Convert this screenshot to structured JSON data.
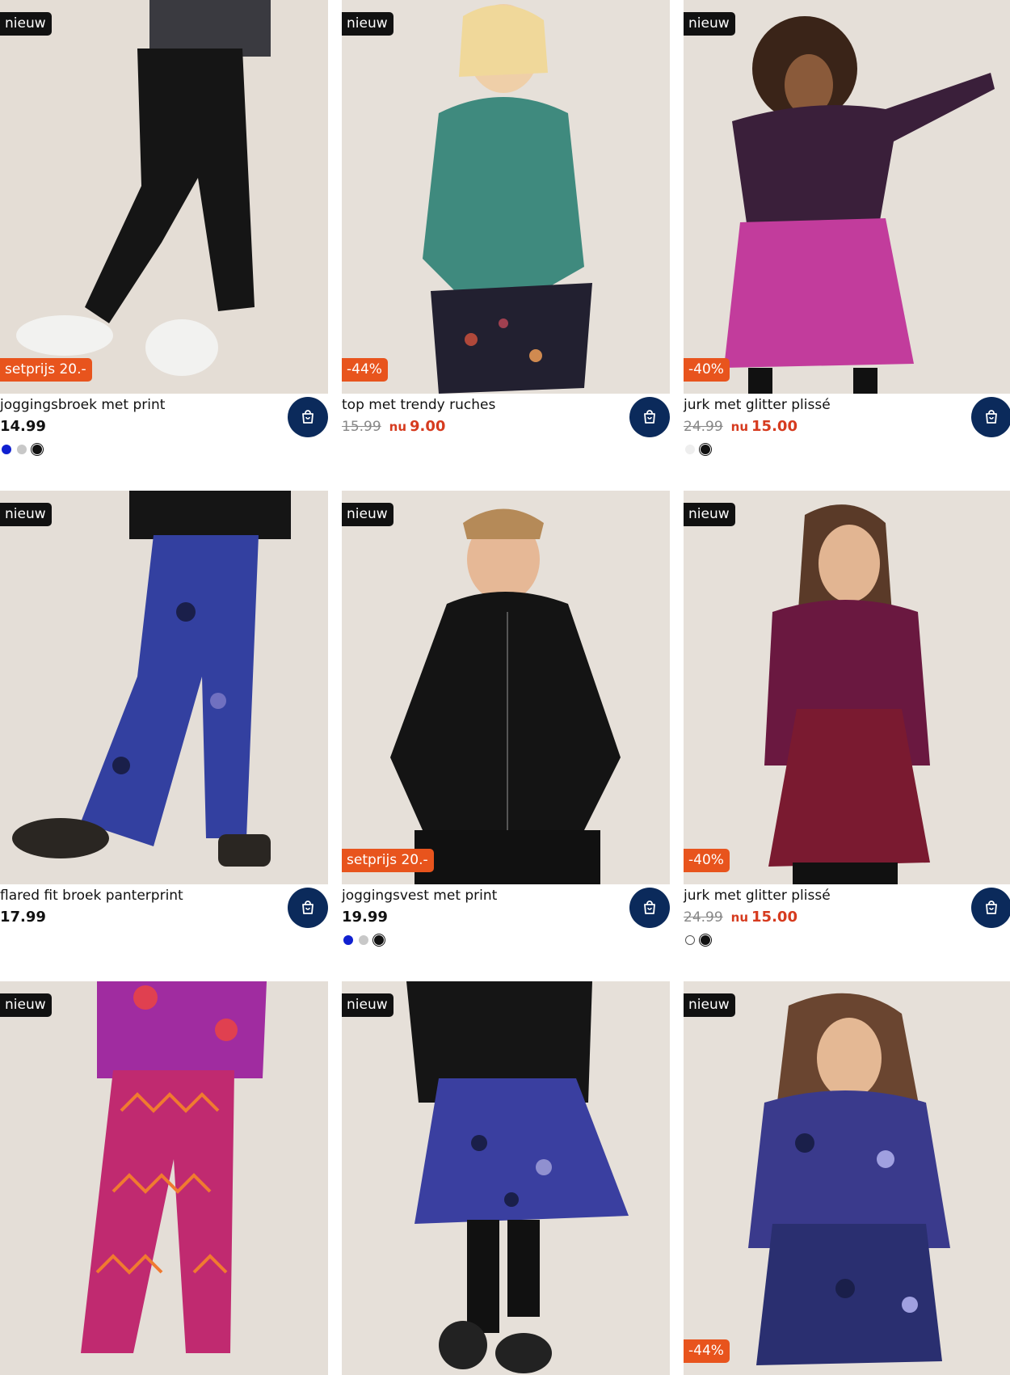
{
  "products": [
    {
      "name": "joggingsbroek met print",
      "badge_top": "nieuw",
      "badge_bottom": "setprijs 20.-",
      "price": "14.99",
      "old_price": "",
      "now_label": "",
      "new_price": "",
      "swatches": [
        "#1020d0",
        "#c8c8c8",
        "#111111"
      ]
    },
    {
      "name": "top met trendy ruches",
      "badge_top": "nieuw",
      "badge_bottom": "-44%",
      "price": "",
      "old_price": "15.99",
      "now_label": "nu",
      "new_price": "9.00",
      "swatches": []
    },
    {
      "name": "jurk met glitter plissé",
      "badge_top": "nieuw",
      "badge_bottom": "-40%",
      "price": "",
      "old_price": "24.99",
      "now_label": "nu",
      "new_price": "15.00",
      "swatches": [
        "#eeeeee",
        "#111111"
      ]
    },
    {
      "name": "flared fit broek panterprint",
      "badge_top": "nieuw",
      "badge_bottom": "",
      "price": "17.99",
      "old_price": "",
      "now_label": "",
      "new_price": "",
      "swatches": []
    },
    {
      "name": "joggingsvest met print",
      "badge_top": "nieuw",
      "badge_bottom": "setprijs 20.-",
      "price": "19.99",
      "old_price": "",
      "now_label": "",
      "new_price": "",
      "swatches": [
        "#1020d0",
        "#c8c8c8",
        "#111111"
      ]
    },
    {
      "name": "jurk met glitter plissé",
      "badge_top": "nieuw",
      "badge_bottom": "-40%",
      "price": "",
      "old_price": "24.99",
      "now_label": "nu",
      "new_price": "15.00",
      "swatches": [
        "#ffffff",
        "#111111"
      ]
    },
    {
      "name": "",
      "badge_top": "nieuw",
      "badge_bottom": "",
      "price": "",
      "old_price": "",
      "now_label": "",
      "new_price": "",
      "swatches": []
    },
    {
      "name": "",
      "badge_top": "nieuw",
      "badge_bottom": "",
      "price": "",
      "old_price": "",
      "now_label": "",
      "new_price": "",
      "swatches": []
    },
    {
      "name": "",
      "badge_top": "nieuw",
      "badge_bottom": "-44%",
      "price": "",
      "old_price": "",
      "now_label": "",
      "new_price": "",
      "swatches": []
    }
  ],
  "icons": {
    "cart": "shopping-bag-icon"
  },
  "colors": {
    "cart_button": "#0b2a5b",
    "sale_badge": "#e8541d",
    "new_badge": "#111111",
    "discount_price": "#d63b1f"
  }
}
